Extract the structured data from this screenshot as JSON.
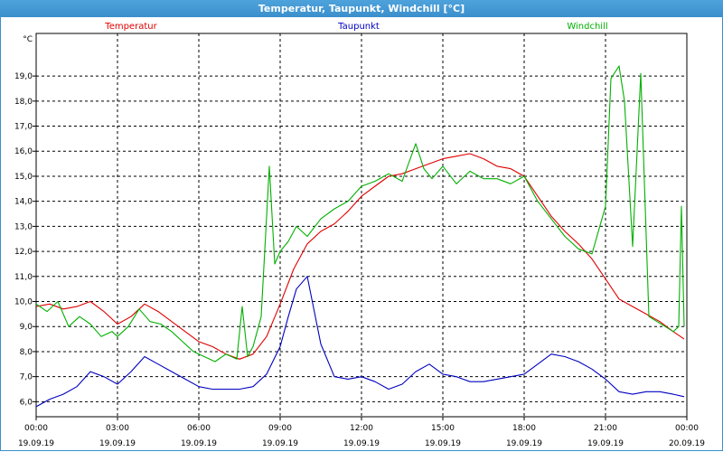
{
  "window": {
    "title": "Temperatur, Taupunkt, Windchill [°C]"
  },
  "chart_data": {
    "type": "line",
    "title": "Temperatur, Taupunkt, Windchill [°C]",
    "ylabel": "°C",
    "ylim": [
      5.4,
      20.7
    ],
    "xlim": [
      0,
      24
    ],
    "grid": true,
    "y_ticks": [
      "6,0",
      "7,0",
      "8,0",
      "9,0",
      "10,0",
      "11,0",
      "12,0",
      "13,0",
      "14,0",
      "15,0",
      "16,0",
      "17,0",
      "18,0",
      "19,0"
    ],
    "x_ticks": [
      {
        "time": "00:00",
        "date": "19.09.19"
      },
      {
        "time": "03:00",
        "date": "19.09.19"
      },
      {
        "time": "06:00",
        "date": "19.09.19"
      },
      {
        "time": "09:00",
        "date": "19.09.19"
      },
      {
        "time": "12:00",
        "date": "19.09.19"
      },
      {
        "time": "15:00",
        "date": "19.09.19"
      },
      {
        "time": "18:00",
        "date": "19.09.19"
      },
      {
        "time": "21:00",
        "date": "19.09.19"
      },
      {
        "time": "00:00",
        "date": "20.09.19"
      }
    ],
    "series": [
      {
        "name": "Temperatur",
        "color": "#e00000",
        "x": [
          0,
          0.5,
          1,
          1.5,
          2,
          2.5,
          3,
          3.5,
          4,
          4.5,
          5,
          5.5,
          6,
          6.5,
          7,
          7.5,
          8,
          8.5,
          9,
          9.5,
          10,
          10.5,
          11,
          11.5,
          12,
          12.5,
          13,
          13.5,
          14,
          14.5,
          15,
          15.5,
          16,
          16.5,
          17,
          17.5,
          18,
          18.5,
          19,
          19.5,
          20,
          20.5,
          21,
          21.5,
          22,
          22.5,
          23,
          23.5,
          23.9
        ],
        "y": [
          9.8,
          9.9,
          9.7,
          9.8,
          10.0,
          9.6,
          9.1,
          9.4,
          9.9,
          9.6,
          9.2,
          8.8,
          8.4,
          8.2,
          7.9,
          7.7,
          7.9,
          8.6,
          9.9,
          11.3,
          12.3,
          12.8,
          13.1,
          13.6,
          14.2,
          14.6,
          15.0,
          15.1,
          15.3,
          15.5,
          15.7,
          15.8,
          15.9,
          15.7,
          15.4,
          15.3,
          15.0,
          14.2,
          13.4,
          12.8,
          12.3,
          11.7,
          10.9,
          10.1,
          9.8,
          9.5,
          9.2,
          8.8,
          8.5
        ]
      },
      {
        "name": "Taupunkt",
        "color": "#0000c0",
        "x": [
          0,
          0.5,
          1,
          1.5,
          2,
          2.5,
          3,
          3.5,
          4,
          4.5,
          5,
          5.5,
          6,
          6.5,
          7,
          7.5,
          8,
          8.5,
          9,
          9.3,
          9.6,
          10,
          10.5,
          11,
          11.5,
          12,
          12.5,
          13,
          13.5,
          14,
          14.5,
          15,
          15.5,
          16,
          16.5,
          17,
          17.5,
          18,
          18.5,
          19,
          19.5,
          20,
          20.5,
          21,
          21.5,
          22,
          22.5,
          23,
          23.5,
          23.9
        ],
        "y": [
          5.8,
          6.1,
          6.3,
          6.6,
          7.2,
          7.0,
          6.7,
          7.2,
          7.8,
          7.5,
          7.2,
          6.9,
          6.6,
          6.5,
          6.5,
          6.5,
          6.6,
          7.1,
          8.2,
          9.4,
          10.5,
          11.0,
          8.3,
          7.0,
          6.9,
          7.0,
          6.8,
          6.5,
          6.7,
          7.2,
          7.5,
          7.1,
          7.0,
          6.8,
          6.8,
          6.9,
          7.0,
          7.1,
          7.5,
          7.9,
          7.8,
          7.6,
          7.3,
          6.9,
          6.4,
          6.3,
          6.4,
          6.4,
          6.3,
          6.2
        ]
      },
      {
        "name": "Windchill",
        "color": "#00b000",
        "x": [
          0,
          0.4,
          0.8,
          1.2,
          1.6,
          2,
          2.4,
          2.8,
          3,
          3.4,
          3.8,
          4.2,
          4.6,
          5,
          5.4,
          5.8,
          6.2,
          6.6,
          7,
          7.4,
          7.6,
          7.8,
          8,
          8.3,
          8.6,
          8.8,
          9,
          9.3,
          9.6,
          10,
          10.5,
          11,
          11.5,
          12,
          12.5,
          13,
          13.5,
          14,
          14.3,
          14.6,
          15,
          15.5,
          16,
          16.5,
          17,
          17.5,
          18,
          18.5,
          19,
          19.5,
          20,
          20.5,
          21,
          21.2,
          21.5,
          21.7,
          22,
          22.3,
          22.6,
          22.9,
          23.2,
          23.5,
          23.7,
          23.8,
          23.9
        ],
        "y": [
          9.9,
          9.6,
          10.0,
          9.0,
          9.4,
          9.1,
          8.6,
          8.8,
          8.6,
          9.0,
          9.7,
          9.2,
          9.1,
          8.8,
          8.4,
          8.0,
          7.8,
          7.6,
          7.9,
          7.7,
          9.8,
          7.8,
          8.2,
          9.4,
          15.4,
          11.5,
          12.0,
          12.4,
          13.0,
          12.6,
          13.3,
          13.7,
          14.0,
          14.6,
          14.8,
          15.1,
          14.8,
          16.3,
          15.3,
          14.9,
          15.4,
          14.7,
          15.2,
          14.9,
          14.9,
          14.7,
          15.0,
          14.0,
          13.3,
          12.6,
          12.1,
          11.9,
          13.8,
          18.9,
          19.4,
          18.0,
          12.2,
          19.1,
          9.4,
          9.2,
          9.0,
          8.8,
          9.0,
          13.8,
          9.0
        ]
      }
    ]
  }
}
